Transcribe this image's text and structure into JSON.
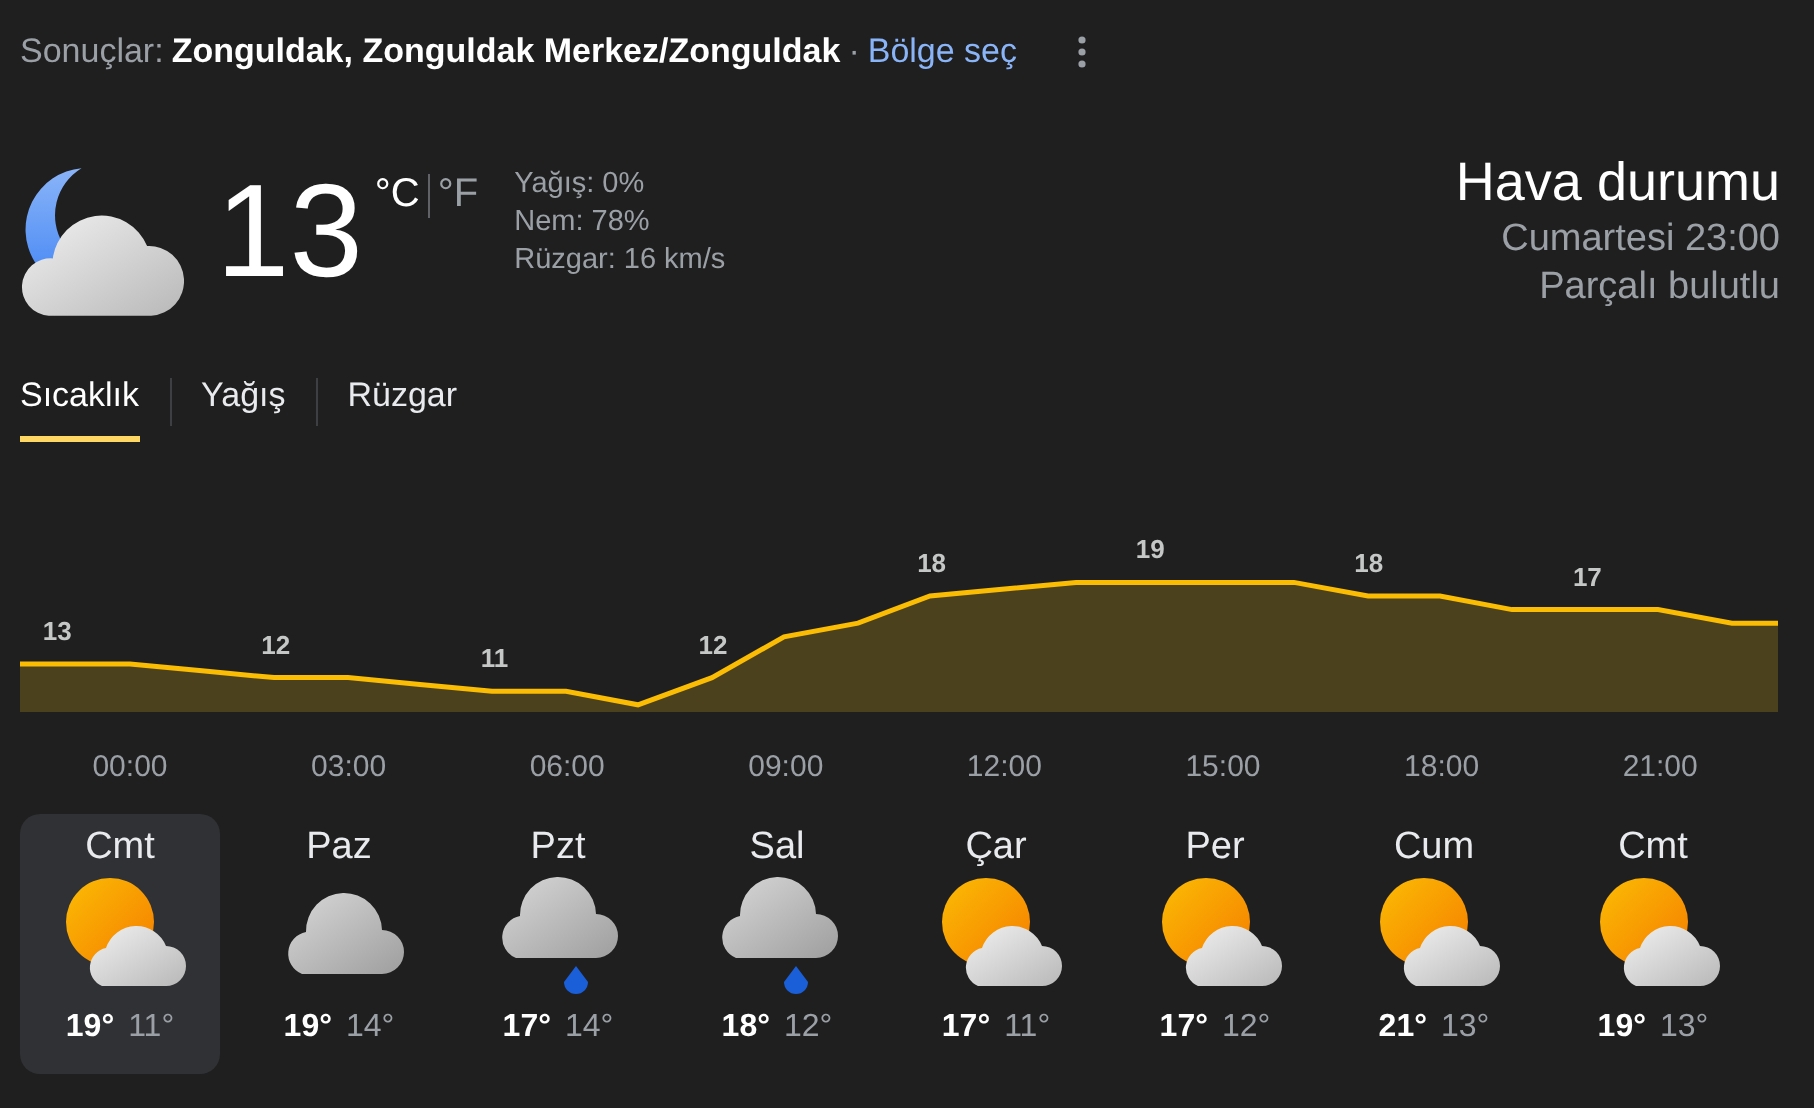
{
  "header": {
    "prefix": "Sonuçlar:",
    "location": "Zonguldak, Zonguldak Merkez/Zonguldak",
    "separator": "·",
    "link": "Bölge seç"
  },
  "current": {
    "kind": "moon_cloud",
    "temperature": "13",
    "units": [
      {
        "label": "°C",
        "selected": true
      },
      {
        "label": "°F",
        "selected": false
      }
    ],
    "details": [
      "Yağış: 0%",
      "Nem: 78%",
      "Rüzgar: 16 km/s"
    ]
  },
  "summary": {
    "title": "Hava durumu",
    "time": "Cumartesi 23:00",
    "condition": "Parçalı bulutlu"
  },
  "tabs": [
    {
      "label": "Sıcaklık",
      "selected": true
    },
    {
      "label": "Yağış",
      "selected": false
    },
    {
      "label": "Rüzgar",
      "selected": false
    }
  ],
  "hourly": {
    "value_labels": [
      "13",
      "12",
      "11",
      "12",
      "18",
      "19",
      "18",
      "17"
    ],
    "times": [
      "00:00",
      "03:00",
      "06:00",
      "09:00",
      "12:00",
      "15:00",
      "18:00",
      "21:00"
    ]
  },
  "days": [
    {
      "day": "Cmt",
      "kind": "sun_cloud",
      "high": "19°",
      "low": "11°",
      "selected": true
    },
    {
      "day": "Paz",
      "kind": "cloud",
      "high": "19°",
      "low": "14°",
      "selected": false
    },
    {
      "day": "Pzt",
      "kind": "rain",
      "high": "17°",
      "low": "14°",
      "selected": false
    },
    {
      "day": "Sal",
      "kind": "rain",
      "high": "18°",
      "low": "12°",
      "selected": false
    },
    {
      "day": "Çar",
      "kind": "sun_cloud",
      "high": "17°",
      "low": "11°",
      "selected": false
    },
    {
      "day": "Per",
      "kind": "sun_cloud",
      "high": "17°",
      "low": "12°",
      "selected": false
    },
    {
      "day": "Cum",
      "kind": "sun_cloud",
      "high": "21°",
      "low": "13°",
      "selected": false
    },
    {
      "day": "Cmt",
      "kind": "sun_cloud",
      "high": "19°",
      "low": "13°",
      "selected": false
    }
  ]
}
